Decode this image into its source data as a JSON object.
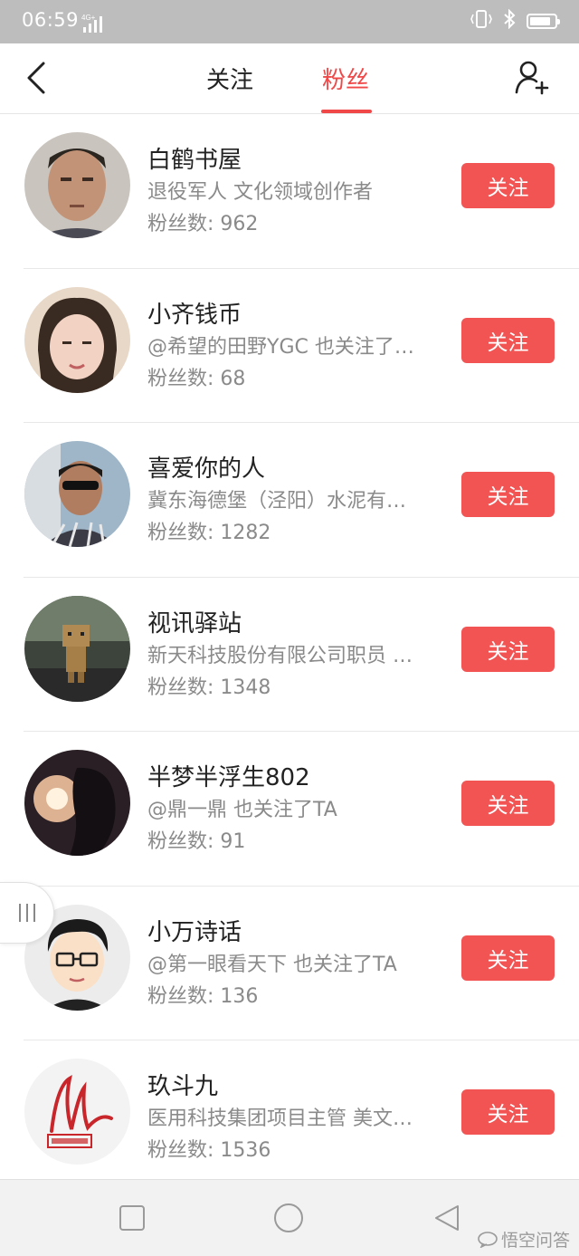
{
  "status_bar": {
    "time": "06:59",
    "network": "4G+"
  },
  "nav": {
    "tabs": [
      {
        "label": "关注"
      },
      {
        "label": "粉丝"
      }
    ]
  },
  "list": [
    {
      "name": "白鹤书屋",
      "desc": "退役军人 文化领域创作者",
      "fans": "粉丝数: 962",
      "button": "关注"
    },
    {
      "name": "小齐钱币",
      "desc": "@希望的田野YGC 也关注了…",
      "fans": "粉丝数: 68",
      "button": "关注"
    },
    {
      "name": "喜爱你的人",
      "desc": "冀东海德堡（泾阳）水泥有…",
      "fans": "粉丝数: 1282",
      "button": "关注"
    },
    {
      "name": "视讯驿站",
      "desc": "新天科技股份有限公司职员 …",
      "fans": "粉丝数: 1348",
      "button": "关注"
    },
    {
      "name": "半梦半浮生802",
      "desc": "@鼎一鼎 也关注了TA",
      "fans": "粉丝数: 91",
      "button": "关注"
    },
    {
      "name": "小万诗话",
      "desc": "@第一眼看天下 也关注了TA",
      "fans": "粉丝数: 136",
      "button": "关注"
    },
    {
      "name": "玖斗九",
      "desc": "医用科技集团项目主管 美文…",
      "fans": "粉丝数: 1536",
      "button": "关注"
    }
  ],
  "watermark": {
    "text": "悟空问答"
  },
  "colors": {
    "accent": "#f04848",
    "button": "#f25454",
    "status_bar": "#bdbdbd",
    "bottom_nav": "#f2f2f2"
  },
  "battery_level": 0.85
}
